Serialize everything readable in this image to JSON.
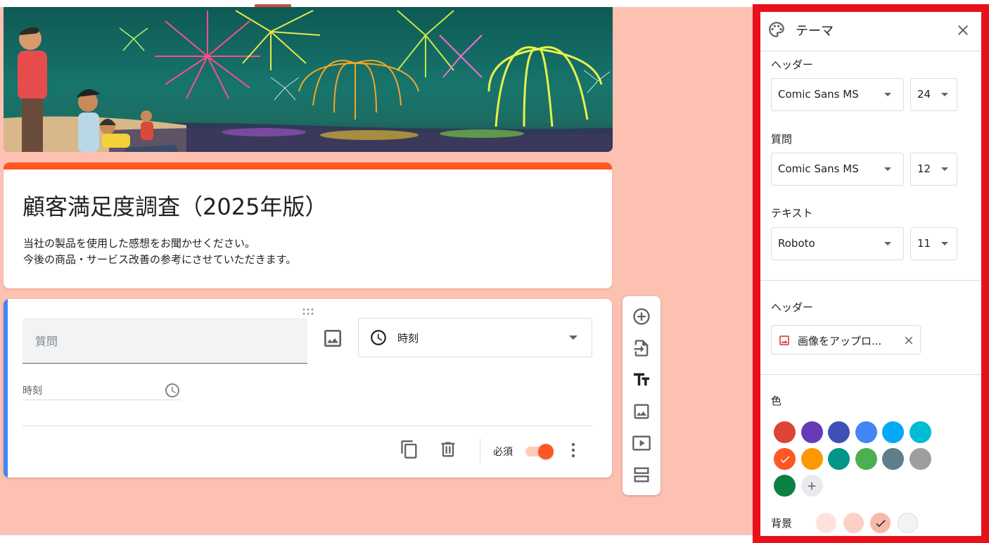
{
  "form": {
    "title": "顧客満足度調査（2025年版）",
    "description_line1": "当社の製品を使用した感想をお聞かせください。",
    "description_line2": "今後の商品・サービス改善の参考にさせていただきます。",
    "accent_color": "#ff5722",
    "background_color": "#fdc1b2"
  },
  "question": {
    "placeholder": "質問",
    "type_label": "時刻",
    "answer_placeholder": "時刻",
    "required_label": "必須",
    "required": true
  },
  "toolbar": {
    "icons": [
      "add-question-icon",
      "import-questions-icon",
      "add-title-icon",
      "add-image-icon",
      "add-video-icon",
      "add-section-icon"
    ]
  },
  "theme_panel": {
    "title": "テーマ",
    "header_label": "ヘッダー",
    "header_font": "Comic Sans MS",
    "header_size": "24",
    "question_label": "質問",
    "question_font": "Comic Sans MS",
    "question_size": "12",
    "text_label": "テキスト",
    "text_font": "Roboto",
    "text_size": "11",
    "header_image_label": "ヘッダー",
    "upload_text": "画像をアップロ...",
    "color_label": "色",
    "colors": [
      "#db4437",
      "#673ab7",
      "#3f51b5",
      "#4285f4",
      "#03a9f4",
      "#00bcd4",
      "#ff5722",
      "#ff9800",
      "#009688",
      "#4caf50",
      "#607d8b",
      "#9e9e9e",
      "#0b8043"
    ],
    "selected_color": "#ff5722",
    "background_label": "背景",
    "backgrounds": [
      "#fde2dd",
      "#fcd0c6",
      "#f7b9a8",
      "#f1f3f4"
    ],
    "selected_background": "#f7b9a8"
  }
}
